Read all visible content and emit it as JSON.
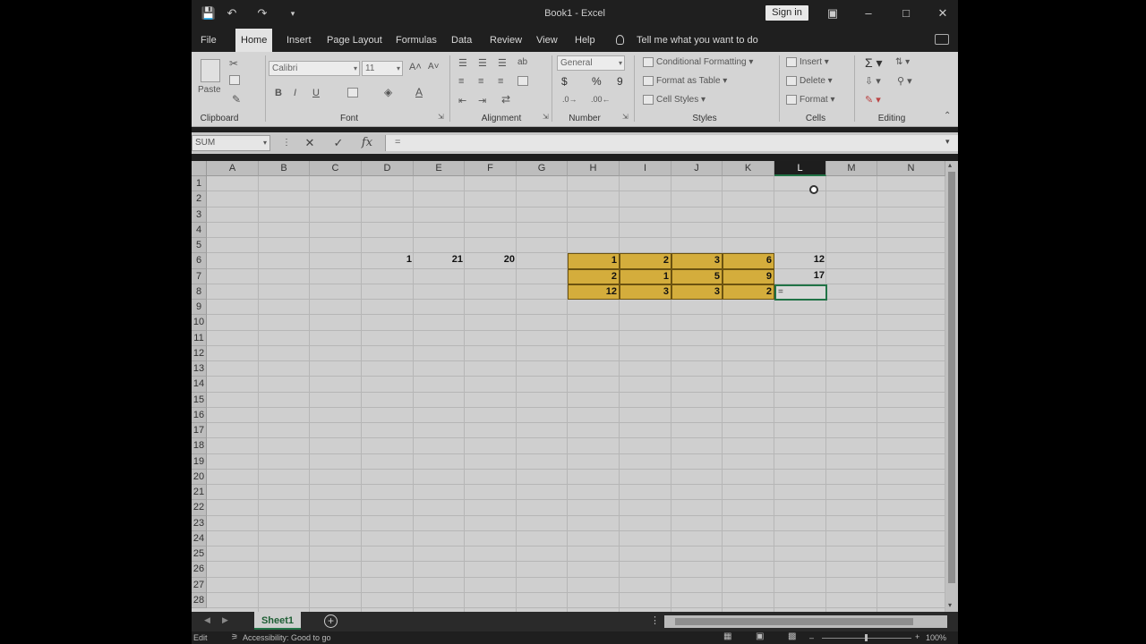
{
  "window": {
    "title": "Book1 - Excel",
    "sign_in": "Sign in"
  },
  "menu": {
    "tabs": [
      "File",
      "Home",
      "Insert",
      "Page Layout",
      "Formulas",
      "Data",
      "Review",
      "View",
      "Help"
    ],
    "active": "Home",
    "tell_me": "Tell me what you want to do"
  },
  "ribbon": {
    "clipboard": {
      "paste": "Paste",
      "label": "Clipboard"
    },
    "font": {
      "name": "Calibri",
      "size": "11",
      "bold": "B",
      "italic": "I",
      "underline": "U",
      "label": "Font"
    },
    "alignment": {
      "label": "Alignment"
    },
    "number": {
      "format": "General",
      "currency": "$",
      "percent": "%",
      "comma": "9",
      "label": "Number"
    },
    "styles": {
      "conditional": "Conditional Formatting",
      "table": "Format as Table",
      "cell": "Cell Styles",
      "label": "Styles"
    },
    "cells": {
      "insert": "Insert",
      "delete": "Delete",
      "format": "Format",
      "label": "Cells"
    },
    "editing": {
      "label": "Editing"
    }
  },
  "formula_bar": {
    "name_box": "SUM",
    "formula": "="
  },
  "grid": {
    "columns": [
      "A",
      "B",
      "C",
      "D",
      "E",
      "F",
      "G",
      "H",
      "I",
      "J",
      "K",
      "L",
      "M",
      "N"
    ],
    "selected_column": "L",
    "rows": [
      "1",
      "2",
      "3",
      "4",
      "5",
      "6",
      "7",
      "8",
      "9",
      "10",
      "11",
      "12",
      "13",
      "14",
      "15",
      "16",
      "17",
      "18",
      "19",
      "20",
      "21",
      "22",
      "23",
      "24",
      "25",
      "26",
      "27",
      "28"
    ],
    "cells": {
      "D6": "1",
      "E6": "21",
      "F6": "20",
      "H6": "1",
      "I6": "2",
      "J6": "3",
      "K6": "6",
      "L6": "12",
      "H7": "2",
      "I7": "1",
      "J7": "5",
      "K7": "9",
      "L7": "17",
      "H8": "12",
      "I8": "3",
      "J8": "3",
      "K8": "2",
      "L8": "="
    },
    "highlight_color": "#d4ad3c"
  },
  "sheets": {
    "active": "Sheet1"
  },
  "status": {
    "mode": "Edit",
    "accessibility": "Accessibility: Good to go",
    "zoom": "100%"
  }
}
